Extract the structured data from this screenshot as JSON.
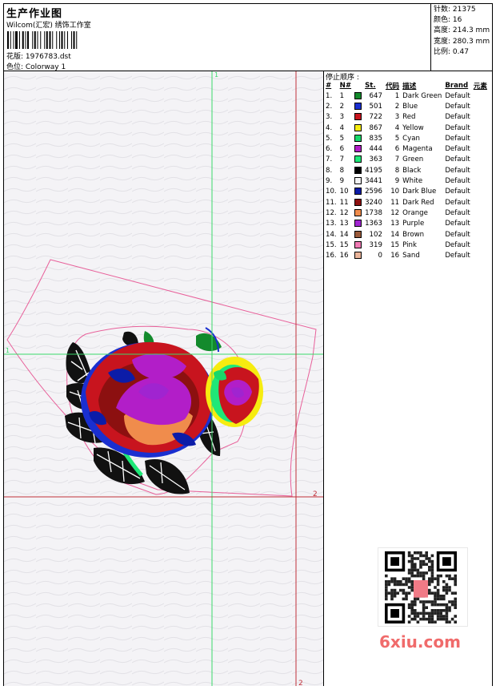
{
  "header": {
    "title": "生产作业图",
    "company": "Wilcom(汇宏) 绣饰工作室",
    "design_label": "花版: 1976783.dst",
    "colorway_label": "色位:  Colorway 1"
  },
  "stats": [
    {
      "label": "针数:",
      "value": "21375"
    },
    {
      "label": "颜色:",
      "value": "16"
    },
    {
      "label": "高度:",
      "value": "214.3 mm"
    },
    {
      "label": "宽度:",
      "value": "280.3 mm"
    },
    {
      "label": "比例:",
      "value": "0.47"
    }
  ],
  "sidebar": {
    "title": "停止顺序 :",
    "columns": [
      "#",
      "N#",
      "St.",
      "代码",
      "描述",
      "Brand",
      "元素"
    ],
    "rows": [
      {
        "n": "1.",
        "needle": "1",
        "st": "647",
        "code": "1",
        "desc": "Dark Green",
        "brand": "Default",
        "color": "#138a2c"
      },
      {
        "n": "2.",
        "needle": "2",
        "st": "501",
        "code": "2",
        "desc": "Blue",
        "brand": "Default",
        "color": "#1a2fd0"
      },
      {
        "n": "3.",
        "needle": "3",
        "st": "722",
        "code": "3",
        "desc": "Red",
        "brand": "Default",
        "color": "#c8141e"
      },
      {
        "n": "4.",
        "needle": "4",
        "st": "867",
        "code": "4",
        "desc": "Yellow",
        "brand": "Default",
        "color": "#f6ec10"
      },
      {
        "n": "5.",
        "needle": "5",
        "st": "835",
        "code": "5",
        "desc": "Cyan",
        "brand": "Default",
        "color": "#18d86a"
      },
      {
        "n": "6.",
        "needle": "6",
        "st": "444",
        "code": "6",
        "desc": "Magenta",
        "brand": "Default",
        "color": "#b21ec8"
      },
      {
        "n": "7.",
        "needle": "7",
        "st": "363",
        "code": "7",
        "desc": "Green",
        "brand": "Default",
        "color": "#1ee878"
      },
      {
        "n": "8.",
        "needle": "8",
        "st": "4195",
        "code": "8",
        "desc": "Black",
        "brand": "Default",
        "color": "#000000"
      },
      {
        "n": "9.",
        "needle": "9",
        "st": "3441",
        "code": "9",
        "desc": "White",
        "brand": "Default",
        "color": "#f4f4f4"
      },
      {
        "n": "10.",
        "needle": "10",
        "st": "2596",
        "code": "10",
        "desc": "Dark Blue",
        "brand": "Default",
        "color": "#0c1ca8"
      },
      {
        "n": "11.",
        "needle": "11",
        "st": "3240",
        "code": "11",
        "desc": "Dark Red",
        "brand": "Default",
        "color": "#8c1010"
      },
      {
        "n": "12.",
        "needle": "12",
        "st": "1738",
        "code": "12",
        "desc": "Orange",
        "brand": "Default",
        "color": "#f08c4c"
      },
      {
        "n": "13.",
        "needle": "13",
        "st": "1363",
        "code": "13",
        "desc": "Purple",
        "brand": "Default",
        "color": "#a024d0"
      },
      {
        "n": "14.",
        "needle": "14",
        "st": "102",
        "code": "14",
        "desc": "Brown",
        "brand": "Default",
        "color": "#9a5a3a"
      },
      {
        "n": "15.",
        "needle": "15",
        "st": "319",
        "code": "15",
        "desc": "Pink",
        "brand": "Default",
        "color": "#f07ab4"
      },
      {
        "n": "16.",
        "needle": "16",
        "st": "0",
        "code": "16",
        "desc": "Sand",
        "brand": "Default",
        "color": "#eab49a"
      }
    ]
  },
  "canvas": {
    "guide_labels": {
      "v1": "1",
      "h1": "1",
      "v2": "2",
      "h2": "2"
    },
    "guide_colors": {
      "green": "#3ad86a",
      "red": "#c0303a",
      "outline": "#e8609a"
    }
  },
  "watermark": {
    "text": "6xiu.com",
    "color": "#f06b6b"
  }
}
